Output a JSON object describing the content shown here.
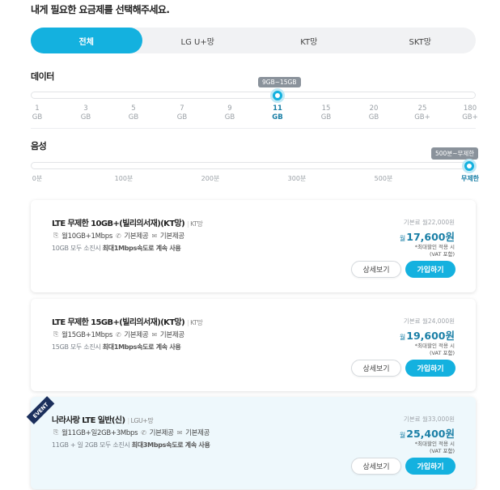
{
  "page_title": "내게 필요한 요금제를 선택해주세요.",
  "tabs": [
    {
      "label": "전체",
      "active": true
    },
    {
      "label": "LG U+망",
      "active": false
    },
    {
      "label": "KT망",
      "active": false
    },
    {
      "label": "SKT망",
      "active": false
    }
  ],
  "data_filter": {
    "label": "데이터",
    "bubble": "9GB~15GB",
    "selected_index": 5,
    "ticks": [
      {
        "num": "1",
        "unit": "GB"
      },
      {
        "num": "3",
        "unit": "GB"
      },
      {
        "num": "5",
        "unit": "GB"
      },
      {
        "num": "7",
        "unit": "GB"
      },
      {
        "num": "9",
        "unit": "GB"
      },
      {
        "num": "11",
        "unit": "GB"
      },
      {
        "num": "15",
        "unit": "GB"
      },
      {
        "num": "20",
        "unit": "GB"
      },
      {
        "num": "25",
        "unit": "GB+"
      },
      {
        "num": "180",
        "unit": "GB+"
      }
    ]
  },
  "voice_filter": {
    "label": "음성",
    "bubble": "500분~무제한",
    "selected_index": 6,
    "ticks": [
      "0분",
      "100분",
      "200분",
      "300분",
      "",
      "500분",
      "무제한"
    ]
  },
  "plans": [
    {
      "name": "LTE 무제한 10GB+(빌리의서재)(KT망)",
      "carrier": "KT망",
      "data": "월10GB+1Mbps",
      "voice": "기본제공",
      "sms": "기본제공",
      "note_prefix": "10GB 모두 소진시 ",
      "note_bold": "최대1Mbps속도로 계속 사용",
      "base_price": "기본료 월22,000원",
      "sale_prefix": "월",
      "sale_price": "17,600원",
      "price_note1": "*최대할인 적용 시",
      "price_note2": "(VAT 포함)",
      "detail_label": "상세보기",
      "join_label": "가입하기",
      "event": false
    },
    {
      "name": "LTE 무제한 15GB+(빌리의서재)(KT망)",
      "carrier": "KT망",
      "data": "월15GB+1Mbps",
      "voice": "기본제공",
      "sms": "기본제공",
      "note_prefix": "15GB 모두 소진시 ",
      "note_bold": "최대1Mbps속도로 계속 사용",
      "base_price": "기본료 월24,000원",
      "sale_prefix": "월",
      "sale_price": "19,600원",
      "price_note1": "*최대할인 적용 시",
      "price_note2": "(VAT 포함)",
      "detail_label": "상세보기",
      "join_label": "가입하기",
      "event": false
    },
    {
      "name": "나라사랑 LTE 일반(신)",
      "carrier": "LGU+망",
      "data": "월11GB+일2GB+3Mbps",
      "voice": "기본제공",
      "sms": "기본제공",
      "note_prefix": "11GB + 일 2GB 모두 소진시 ",
      "note_bold": "최대3Mbps속도로 계속 사용",
      "base_price": "기본료 월33,000원",
      "sale_prefix": "월",
      "sale_price": "25,400원",
      "price_note1": "*최대할인 적용 시",
      "price_note2": "(VAT 포함)",
      "detail_label": "상세보기",
      "join_label": "가입하기",
      "event": true,
      "event_label": "EVENT"
    }
  ],
  "colors": {
    "accent": "#14b1df",
    "price": "#1a7fa6",
    "event_bg": "#eef8fc"
  }
}
